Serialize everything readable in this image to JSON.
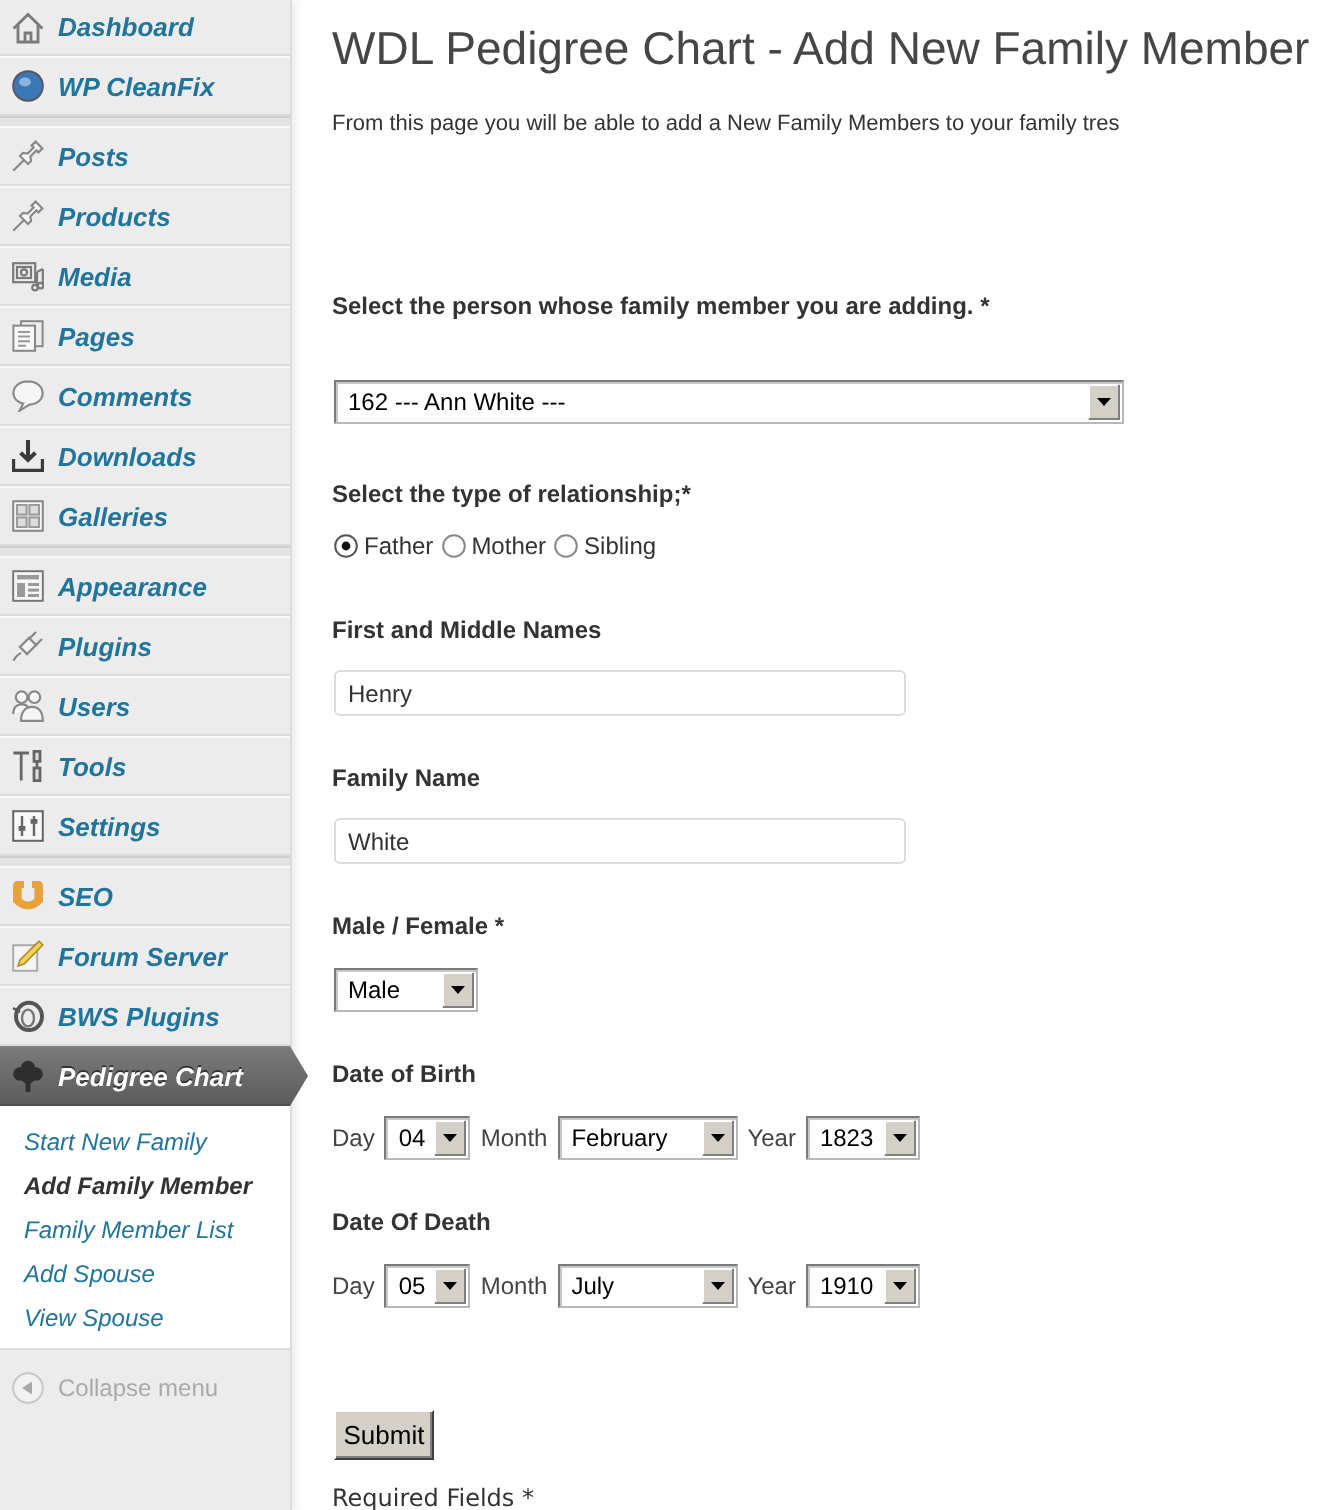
{
  "sidebar": {
    "groups": [
      {
        "items": [
          {
            "label": "Dashboard",
            "selected": false
          },
          {
            "label": "WP CleanFix",
            "selected": false
          }
        ]
      },
      {
        "items": [
          {
            "label": "Posts",
            "selected": false
          },
          {
            "label": "Products",
            "selected": false
          },
          {
            "label": "Media",
            "selected": false
          },
          {
            "label": "Pages",
            "selected": false
          },
          {
            "label": "Comments",
            "selected": false
          },
          {
            "label": "Downloads",
            "selected": false
          },
          {
            "label": "Galleries",
            "selected": false
          }
        ]
      },
      {
        "items": [
          {
            "label": "Appearance",
            "selected": false
          },
          {
            "label": "Plugins",
            "selected": false
          },
          {
            "label": "Users",
            "selected": false
          },
          {
            "label": "Tools",
            "selected": false
          },
          {
            "label": "Settings",
            "selected": false
          }
        ]
      },
      {
        "items": [
          {
            "label": "SEO",
            "selected": false
          },
          {
            "label": "Forum Server",
            "selected": false
          },
          {
            "label": "BWS Plugins",
            "selected": false
          },
          {
            "label": "Pedigree Chart",
            "selected": true
          }
        ]
      }
    ],
    "submenu": [
      {
        "label": "Start New Family",
        "selected": false
      },
      {
        "label": "Add Family Member",
        "selected": true
      },
      {
        "label": "Family Member List",
        "selected": false
      },
      {
        "label": "Add Spouse",
        "selected": false
      },
      {
        "label": "View Spouse",
        "selected": false
      }
    ],
    "collapse": "Collapse menu"
  },
  "page": {
    "title": "WDL Pedigree Chart - Add New Family Member",
    "intro": "From this page you will be able to add a New Family Members to your family tres"
  },
  "form": {
    "person": {
      "label": "Select the person whose family member you are adding. *",
      "value": "162 --- Ann White ---"
    },
    "relationship": {
      "label": "Select the type of relationship;*",
      "options": [
        {
          "label": "Father",
          "selected": true
        },
        {
          "label": "Mother",
          "selected": false
        },
        {
          "label": "Sibling",
          "selected": false
        }
      ]
    },
    "first_names": {
      "label": "First and Middle Names",
      "value": "Henry"
    },
    "family_name": {
      "label": "Family Name",
      "value": "White"
    },
    "gender": {
      "label": "Male / Female *",
      "value": "Male"
    },
    "birth": {
      "label": "Date of Birth",
      "parts": [
        {
          "label": "Day",
          "value": "04"
        },
        {
          "label": "Month",
          "value": "February"
        },
        {
          "label": "Year",
          "value": "1823"
        }
      ]
    },
    "death": {
      "label": "Date Of Death",
      "parts": [
        {
          "label": "Day",
          "value": "05"
        },
        {
          "label": "Month",
          "value": "July"
        },
        {
          "label": "Year",
          "value": "1910"
        }
      ]
    },
    "submit": "Submit",
    "required_note": "Required Fields *"
  }
}
